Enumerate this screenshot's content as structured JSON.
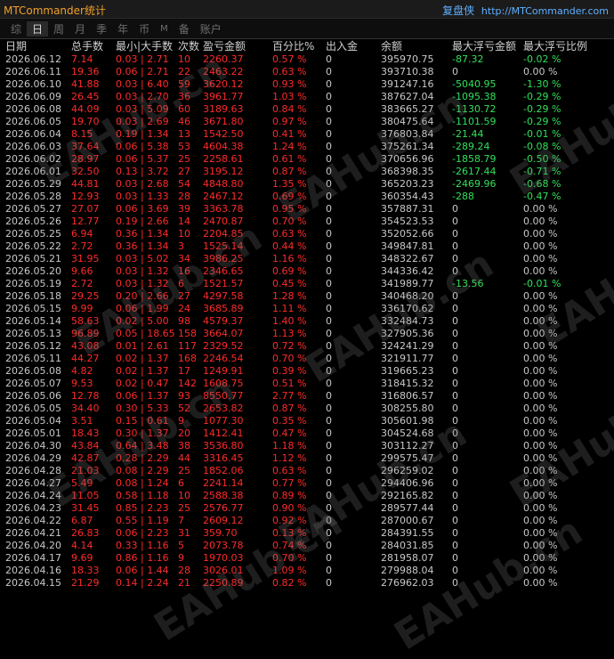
{
  "titlebar": {
    "app_title": "MTCommander统计",
    "brand_cn": "复盘侠",
    "brand_url": "http://MTCommander.com"
  },
  "tabs": [
    "综",
    "日",
    "周",
    "月",
    "季",
    "年",
    "币",
    "M",
    "备",
    "账户"
  ],
  "active_tab": 1,
  "table": {
    "headers": [
      "日期",
      "总手数",
      "最小|大手数",
      "次数",
      "盈亏金额",
      "百分比%",
      "出入金",
      "余额",
      "最大浮亏金额",
      "最大浮亏比例"
    ],
    "rows": [
      [
        "2026.06.12",
        "7.14",
        "0.03 | 2.71",
        "10",
        "2260.37",
        "0.57 %",
        "0",
        "395970.75",
        "-87.32",
        "-0.02 %"
      ],
      [
        "2026.06.11",
        "19.36",
        "0.06 | 2.71",
        "22",
        "2463.22",
        "0.63 %",
        "0",
        "393710.38",
        "0",
        "0.00 %"
      ],
      [
        "2026.06.10",
        "41.88",
        "0.03 | 6.40",
        "59",
        "3620.12",
        "0.93 %",
        "0",
        "391247.16",
        "-5040.95",
        "-1.30 %"
      ],
      [
        "2026.06.09",
        "26.45",
        "0.03 | 2.70",
        "36",
        "3961.77",
        "1.03 %",
        "0",
        "387627.04",
        "-1095.38",
        "-0.29 %"
      ],
      [
        "2026.06.08",
        "44.09",
        "0.03 | 5.09",
        "60",
        "3189.63",
        "0.84 %",
        "0",
        "383665.27",
        "-1130.72",
        "-0.29 %"
      ],
      [
        "2026.06.05",
        "19.70",
        "0.03 | 2.69",
        "46",
        "3671.80",
        "0.97 %",
        "0",
        "380475.64",
        "-1101.59",
        "-0.29 %"
      ],
      [
        "2026.06.04",
        "8.15",
        "0.19 | 1.34",
        "13",
        "1542.50",
        "0.41 %",
        "0",
        "376803.84",
        "-21.44",
        "-0.01 %"
      ],
      [
        "2026.06.03",
        "37.64",
        "0.06 | 5.38",
        "53",
        "4604.38",
        "1.24 %",
        "0",
        "375261.34",
        "-289.24",
        "-0.08 %"
      ],
      [
        "2026.06.02",
        "28.97",
        "0.06 | 5.37",
        "25",
        "2258.61",
        "0.61 %",
        "0",
        "370656.96",
        "-1858.79",
        "-0.50 %"
      ],
      [
        "2026.06.01",
        "32.50",
        "0.13 | 3.72",
        "27",
        "3195.12",
        "0.87 %",
        "0",
        "368398.35",
        "-2617.44",
        "-0.71 %"
      ],
      [
        "2026.05.29",
        "44.81",
        "0.03 | 2.68",
        "54",
        "4848.80",
        "1.35 %",
        "0",
        "365203.23",
        "-2469.96",
        "-0.68 %"
      ],
      [
        "2026.05.28",
        "12.93",
        "0.03 | 1.33",
        "28",
        "2467.12",
        "0.69 %",
        "0",
        "360354.43",
        "-288",
        "-0.47 %"
      ],
      [
        "2026.05.27",
        "27.07",
        "0.06 | 3.69",
        "39",
        "3363.78",
        "0.95 %",
        "0",
        "357887.31",
        "0",
        "0.00 %"
      ],
      [
        "2026.05.26",
        "12.77",
        "0.19 | 2.66",
        "14",
        "2470.87",
        "0.70 %",
        "0",
        "354523.53",
        "0",
        "0.00 %"
      ],
      [
        "2026.05.25",
        "6.94",
        "0.36 | 1.34",
        "10",
        "2204.85",
        "0.63 %",
        "0",
        "352052.66",
        "0",
        "0.00 %"
      ],
      [
        "2026.05.22",
        "2.72",
        "0.36 | 1.34",
        "3",
        "1525.14",
        "0.44 %",
        "0",
        "349847.81",
        "0",
        "0.00 %"
      ],
      [
        "2026.05.21",
        "31.95",
        "0.03 | 5.02",
        "34",
        "3986.25",
        "1.16 %",
        "0",
        "348322.67",
        "0",
        "0.00 %"
      ],
      [
        "2026.05.20",
        "9.66",
        "0.03 | 1.32",
        "16",
        "2346.65",
        "0.69 %",
        "0",
        "344336.42",
        "0",
        "0.00 %"
      ],
      [
        "2026.05.19",
        "2.72",
        "0.03 | 1.32",
        "6",
        "1521.57",
        "0.45 %",
        "0",
        "341989.77",
        "-13.56",
        "-0.01 %"
      ],
      [
        "2026.05.18",
        "29.25",
        "0.20 | 2.66",
        "27",
        "4297.58",
        "1.28 %",
        "0",
        "340468.20",
        "0",
        "0.00 %"
      ],
      [
        "2026.05.15",
        "9.99",
        "0.06 | 1.99",
        "24",
        "3685.89",
        "1.11 %",
        "0",
        "336170.62",
        "0",
        "0.00 %"
      ],
      [
        "2026.05.14",
        "58.63",
        "0.02 | 5.00",
        "98",
        "4579.37",
        "1.40 %",
        "0",
        "332484.73",
        "0",
        "0.00 %"
      ],
      [
        "2026.05.13",
        "96.89",
        "0.05 | 18.65",
        "158",
        "3664.07",
        "1.13 %",
        "0",
        "327905.36",
        "0",
        "0.00 %"
      ],
      [
        "2026.05.12",
        "43.08",
        "0.01 | 2.61",
        "117",
        "2329.52",
        "0.72 %",
        "0",
        "324241.29",
        "0",
        "0.00 %"
      ],
      [
        "2026.05.11",
        "44.27",
        "0.02 | 1.37",
        "168",
        "2246.54",
        "0.70 %",
        "0",
        "321911.77",
        "0",
        "0.00 %"
      ],
      [
        "2026.05.08",
        "4.82",
        "0.02 | 1.37",
        "17",
        "1249.91",
        "0.39 %",
        "0",
        "319665.23",
        "0",
        "0.00 %"
      ],
      [
        "2026.05.07",
        "9.53",
        "0.02 | 0.47",
        "142",
        "1608.75",
        "0.51 %",
        "0",
        "318415.32",
        "0",
        "0.00 %"
      ],
      [
        "2026.05.06",
        "12.78",
        "0.06 | 1.37",
        "93",
        "8550.77",
        "2.77 %",
        "0",
        "316806.57",
        "0",
        "0.00 %"
      ],
      [
        "2026.05.05",
        "34.40",
        "0.30 | 5.33",
        "52",
        "2653.82",
        "0.87 %",
        "0",
        "308255.80",
        "0",
        "0.00 %"
      ],
      [
        "2026.05.04",
        "3.51",
        "0.15 | 0.61",
        "9",
        "1077.30",
        "0.35 %",
        "0",
        "305601.98",
        "0",
        "0.00 %"
      ],
      [
        "2026.05.01",
        "18.43",
        "0.30 | 1.37",
        "20",
        "1412.41",
        "0.47 %",
        "0",
        "304524.68",
        "0",
        "0.00 %"
      ],
      [
        "2026.04.30",
        "43.84",
        "0.64 | 3.48",
        "38",
        "3536.80",
        "1.18 %",
        "0",
        "303112.27",
        "0",
        "0.00 %"
      ],
      [
        "2026.04.29",
        "42.87",
        "0.28 | 2.29",
        "44",
        "3316.45",
        "1.12 %",
        "0",
        "299575.47",
        "0",
        "0.00 %"
      ],
      [
        "2026.04.28",
        "21.03",
        "0.08 | 2.29",
        "25",
        "1852.06",
        "0.63 %",
        "0",
        "296259.02",
        "0",
        "0.00 %"
      ],
      [
        "2026.04.27",
        "5.49",
        "0.08 | 1.24",
        "6",
        "2241.14",
        "0.77 %",
        "0",
        "294406.96",
        "0",
        "0.00 %"
      ],
      [
        "2026.04.24",
        "11.05",
        "0.58 | 1.18",
        "10",
        "2588.38",
        "0.89 %",
        "0",
        "292165.82",
        "0",
        "0.00 %"
      ],
      [
        "2026.04.23",
        "31.45",
        "0.85 | 2.23",
        "25",
        "2576.77",
        "0.90 %",
        "0",
        "289577.44",
        "0",
        "0.00 %"
      ],
      [
        "2026.04.22",
        "6.87",
        "0.55 | 1.19",
        "7",
        "2609.12",
        "0.92 %",
        "0",
        "287000.67",
        "0",
        "0.00 %"
      ],
      [
        "2026.04.21",
        "26.83",
        "0.06 | 2.23",
        "31",
        "359.70",
        "0.13 %",
        "0",
        "284391.55",
        "0",
        "0.00 %"
      ],
      [
        "2026.04.20",
        "4.14",
        "0.33 | 1.16",
        "5",
        "2073.78",
        "0.74 %",
        "0",
        "284031.85",
        "0",
        "0.00 %"
      ],
      [
        "2026.04.17",
        "9.69",
        "0.86 | 1.16",
        "9",
        "1970.03",
        "0.70 %",
        "0",
        "281958.07",
        "0",
        "0.00 %"
      ],
      [
        "2026.04.16",
        "18.33",
        "0.06 | 1.44",
        "28",
        "3026.01",
        "1.09 %",
        "0",
        "279988.04",
        "0",
        "0.00 %"
      ],
      [
        "2026.04.15",
        "21.29",
        "0.14 | 2.24",
        "21",
        "2250.89",
        "0.82 %",
        "0",
        "276962.03",
        "0",
        "0.00 %"
      ]
    ]
  },
  "watermark": "EAHub.cn",
  "colors": {
    "title": "#f0a028",
    "brand": "#5fb0ff",
    "profit": "#ff2a2a",
    "drawdown": "#32e05a"
  }
}
